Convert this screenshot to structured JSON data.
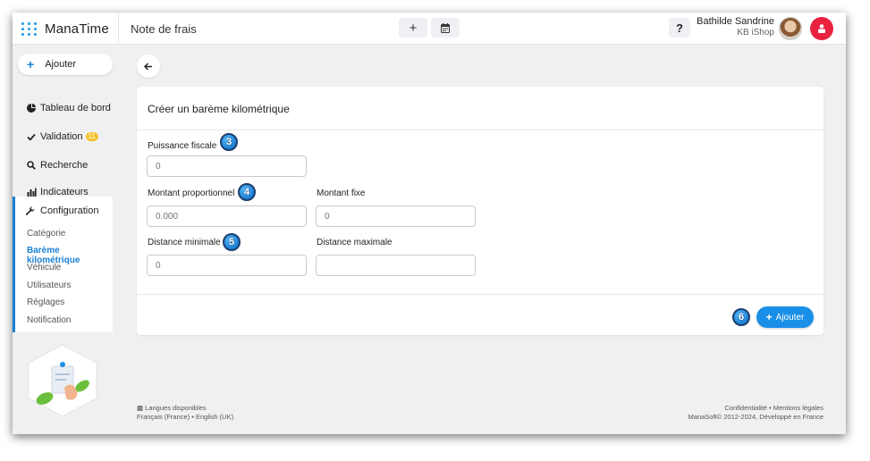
{
  "app": {
    "brand": "ManaTime",
    "page_title": "Note de frais"
  },
  "toolbar": {
    "add_icon": "plus-icon",
    "calendar_icon": "calendar-icon",
    "help_label": "?"
  },
  "user": {
    "name": "Bathilde Sandrine",
    "company": "KB iShop"
  },
  "sidebar": {
    "add_label": "Ajouter",
    "items": [
      {
        "label": "Tableau de bord",
        "icon": "pie-chart-icon"
      },
      {
        "label": "Validation",
        "icon": "check-icon",
        "badge": "11"
      },
      {
        "label": "Recherche",
        "icon": "search-icon"
      },
      {
        "label": "Indicateurs",
        "icon": "bar-chart-icon"
      }
    ],
    "config": {
      "title": "Configuration",
      "icon": "wrench-icon",
      "subitems": [
        "Catégorie",
        "Barème kilométrique",
        "Véhicule",
        "Utilisateurs",
        "Réglages",
        "Notification"
      ],
      "active": "Barème kilométrique"
    }
  },
  "form": {
    "title": "Créer un barème kilométrique",
    "fields": {
      "puissance": {
        "label": "Puissance fiscale",
        "placeholder": "0"
      },
      "montant_prop": {
        "label": "Montant proportionnel",
        "placeholder": "0.000"
      },
      "montant_fixe": {
        "label": "Montant fixe",
        "placeholder": "0"
      },
      "distance_min": {
        "label": "Distance minimale",
        "placeholder": "0"
      },
      "distance_max": {
        "label": "Distance maximale",
        "placeholder": ""
      }
    },
    "submit_label": "Ajouter",
    "steps": [
      "3",
      "4",
      "5",
      "6"
    ]
  },
  "footer": {
    "languages_title": "Langues disponibles",
    "languages": "Français (France) • English (UK)",
    "links": "Confidentialité • Mentions légales",
    "copyright": "ManaSoft© 2012-2024, Développé en France"
  },
  "colors": {
    "accent": "#1a7fd6",
    "logout": "#e8213f",
    "badge": "#f5c12a"
  }
}
